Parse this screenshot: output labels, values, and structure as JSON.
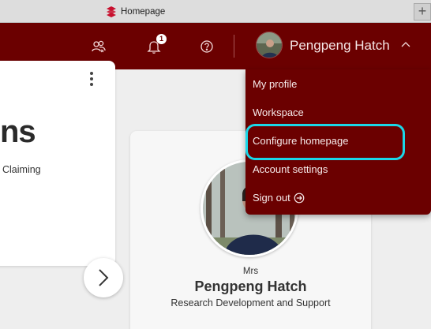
{
  "browser": {
    "tab_title": "Homepage",
    "new_tab_symbol": "+"
  },
  "header": {
    "notification_count": "1",
    "user_name": "Pengpeng Hatch",
    "icons": [
      "people-icon",
      "bell-icon",
      "help-icon",
      "chevron-up-icon"
    ],
    "brand_color": "#6b0000"
  },
  "user_menu": {
    "items": [
      {
        "label": "My profile"
      },
      {
        "label": "Workspace"
      },
      {
        "label": "Configure homepage"
      },
      {
        "label": "Account settings"
      },
      {
        "label": "Sign out"
      }
    ],
    "highlighted_item": "Configure homepage",
    "highlight_color": "#1bd7e8"
  },
  "left_card": {
    "heading_fragment": "ns",
    "text_fragment": "Claiming"
  },
  "profile_card": {
    "salutation": "Mrs",
    "name": "Pengpeng Hatch",
    "department": "Research Development and Support"
  }
}
